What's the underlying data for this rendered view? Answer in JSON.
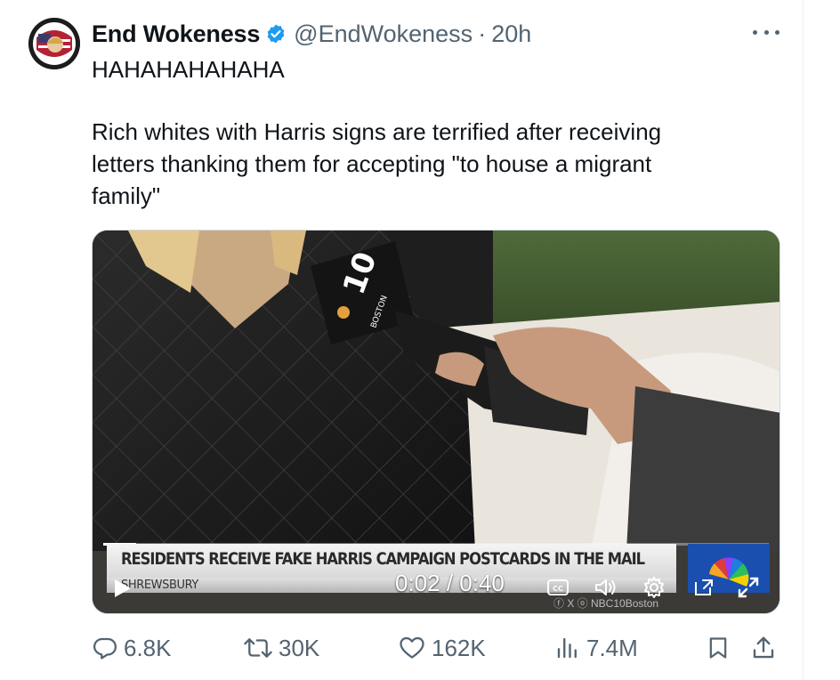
{
  "tweet": {
    "display_name": "End Wokeness",
    "handle": "@EndWokeness",
    "separator": "·",
    "time": "20h",
    "text_lines": [
      "HAHAHAHAHAHA",
      "",
      "Rich whites with Harris signs are terrified after receiving",
      "letters thanking them for accepting \"to house a migrant",
      "family\""
    ],
    "avatar_icon": "profile-avatar",
    "verified_icon": "verified-badge-icon",
    "colors": {
      "verified": "#1d9bf0",
      "secondary": "#536471"
    }
  },
  "video": {
    "headline": "RESIDENTS RECEIVE FAKE HARRIS CAMPAIGN POSTCARDS IN THE MAIL",
    "location": "SHREWSBURY",
    "current_time": "0:02",
    "duration": "0:40",
    "time_separator": " / ",
    "watermark": "ⓕ X ⓞ NBC10Boston",
    "mic_flag_number": "10",
    "mic_flag_text": "BOSTON",
    "progress": 0.05,
    "controls": [
      "play-icon",
      "captions-icon",
      "volume-icon",
      "settings-icon",
      "picture-in-picture-icon",
      "fullscreen-icon"
    ],
    "captions_label": "CC"
  },
  "actions": {
    "replies": "6.8K",
    "reposts": "30K",
    "likes": "162K",
    "views": "7.4M"
  }
}
